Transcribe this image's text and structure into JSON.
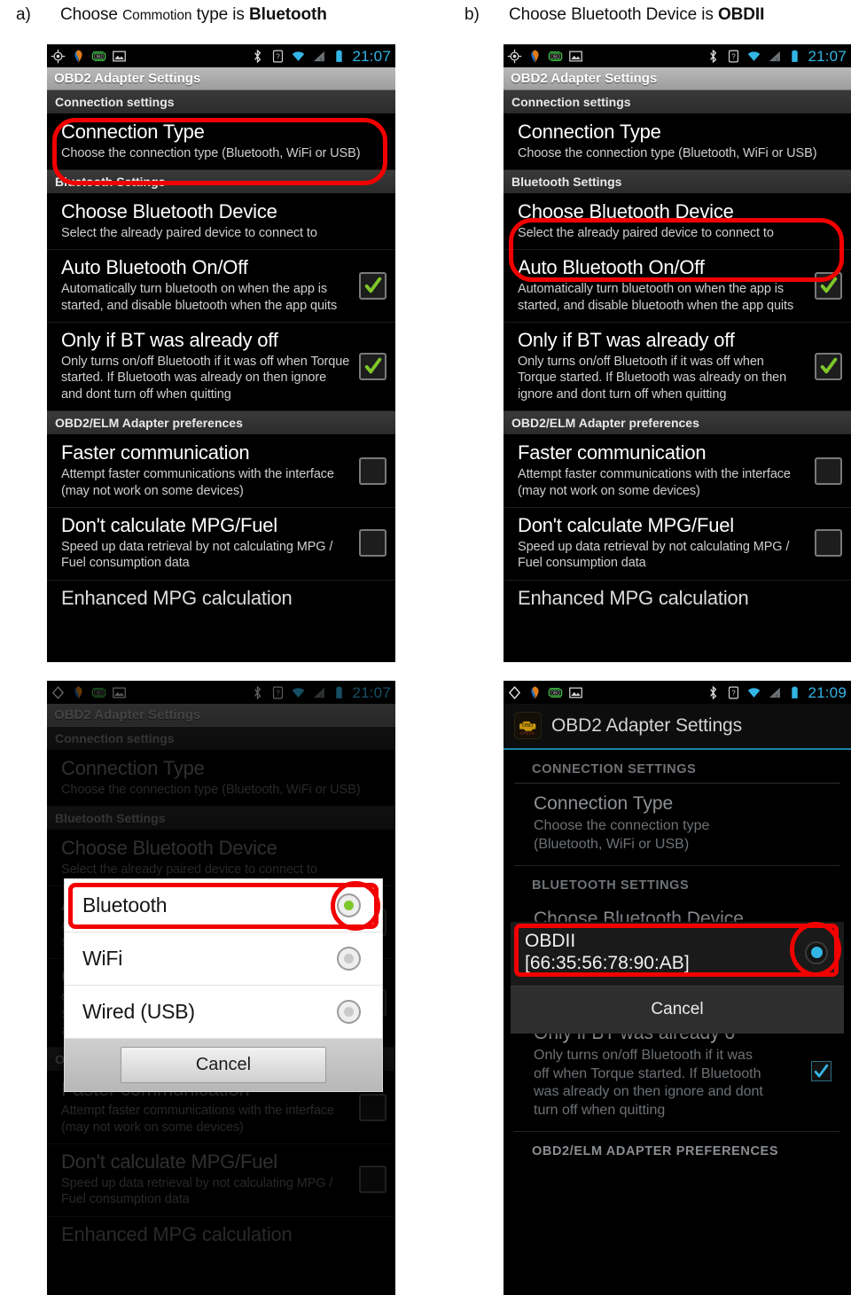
{
  "captions": {
    "a": {
      "label": "a)",
      "part1": "Choose ",
      "small": "Commotion",
      "part2": " type is ",
      "bold": "Bluetooth"
    },
    "b": {
      "label": "b)",
      "part1": "Choose Bluetooth Device is ",
      "bold": "OBDII"
    }
  },
  "statusbar": {
    "clock_a": "21:07",
    "clock_b": "21:07",
    "clock_c": "21:07",
    "clock_d": "21:09",
    "icons_left": [
      "gps-icon",
      "torque-icon",
      "obd-icon",
      "gallery-icon"
    ],
    "icons_right": [
      "bluetooth-icon",
      "sim-icon",
      "wifi-icon",
      "signal-icon",
      "battery-icon"
    ]
  },
  "app": {
    "title": "OBD2 Adapter Settings",
    "title_upper": "OBD2 Adapter Settings"
  },
  "sections": {
    "connection": "Connection settings",
    "bluetooth": "Bluetooth Settings",
    "adapter": "OBD2/ELM Adapter preferences",
    "connection_upper": "CONNECTION SETTINGS",
    "bluetooth_upper": "BLUETOOTH SETTINGS",
    "adapter_upper": "OBD2/ELM ADAPTER PREFERENCES"
  },
  "prefs": {
    "connection_type": {
      "title": "Connection Type",
      "summary": "Choose the connection type (Bluetooth, WiFi or USB)",
      "summary_wrapped": "Choose the connection type (Bluetooth, WiFi or USB)"
    },
    "choose_device": {
      "title": "Choose Bluetooth Device",
      "summary": "Select the already paired device to connect to"
    },
    "auto_bt": {
      "title": "Auto Bluetooth On/Off",
      "summary": "Automatically turn bluetooth on when the app is started, and disable bluetooth when the app quits",
      "summary_tail": "on when the app is started, and disable bluetooth when the app quits",
      "checked": true
    },
    "only_if_off": {
      "title": "Only if BT was already off",
      "title_clipped": "Only if BT was already o",
      "summary": "Only turns on/off Bluetooth if it was off when Torque started. If Bluetooth was already on then ignore and dont turn off when quitting",
      "checked": true
    },
    "faster_comm": {
      "title": "Faster communication",
      "summary": "Attempt faster communications with the interface (may not work on some devices)",
      "checked": false
    },
    "no_mpg": {
      "title": "Don't calculate MPG/Fuel",
      "summary": "Speed up data retrieval by not calculating MPG / Fuel consumption data",
      "checked": false
    },
    "enhanced_mpg": {
      "title": "Enhanced MPG calculation"
    }
  },
  "dialog_connection": {
    "options": [
      {
        "label": "Bluetooth",
        "selected": true
      },
      {
        "label": "WiFi",
        "selected": false
      },
      {
        "label": "Wired (USB)",
        "selected": false
      }
    ],
    "cancel": "Cancel"
  },
  "dialog_device": {
    "option_line1": "OBDII",
    "option_line2": "[66:35:56:78:90:AB]",
    "selected": true,
    "cancel": "Cancel"
  },
  "colors": {
    "accent_red": "#f20000",
    "accent_blue": "#33b5e5",
    "check_green": "#7ec72a"
  }
}
